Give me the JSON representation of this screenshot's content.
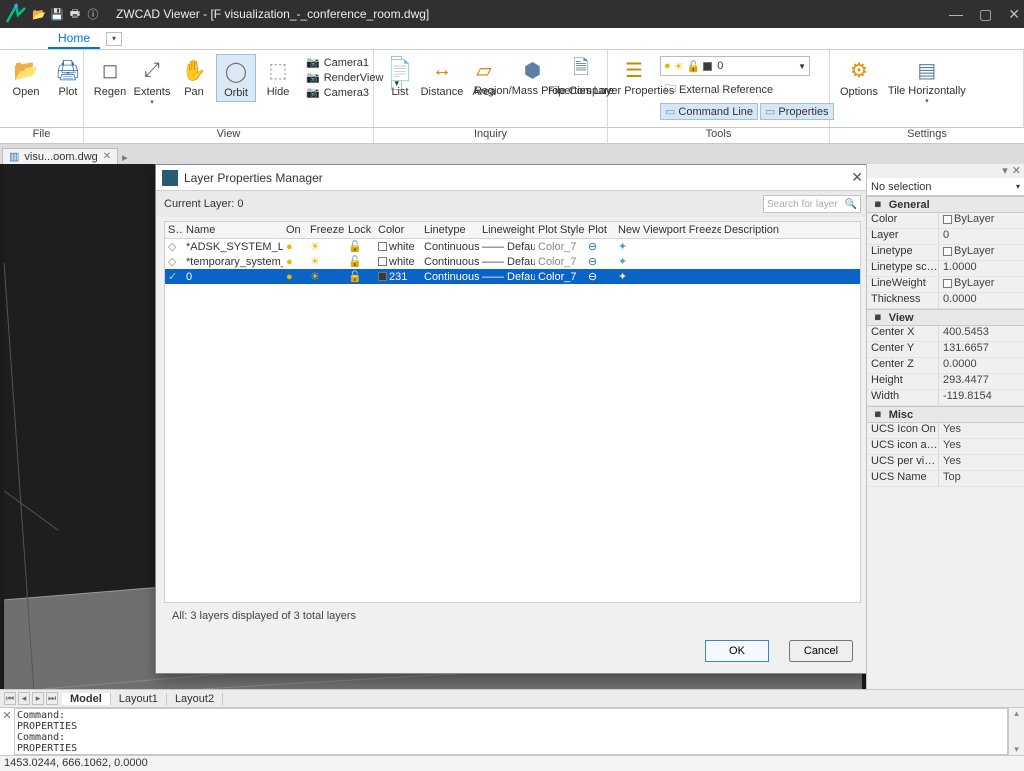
{
  "titlebar": {
    "app": "ZWCAD Viewer",
    "doc": "[F            visualization_-_conference_room.dwg]"
  },
  "menu": {
    "home": "Home"
  },
  "ribbon": {
    "file": {
      "label": "File",
      "open": "Open",
      "plot": "Plot"
    },
    "view": {
      "label": "View",
      "regen": "Regen",
      "extents": "Extents",
      "pan": "Pan",
      "orbit": "Orbit",
      "hide": "Hide",
      "cam1": "Camera1",
      "render": "RenderView",
      "cam3": "Camera3"
    },
    "inquiry": {
      "label": "Inquiry",
      "list": "List",
      "distance": "Distance",
      "area": "Area",
      "regionmass": "Region/Mass\nProperties",
      "compare": "File\nCompare"
    },
    "tools": {
      "label": "Tools",
      "layerprops": "Layer\nProperties",
      "xref": "External Reference",
      "cmdline": "Command Line",
      "props": "Properties",
      "combo": "0"
    },
    "settings": {
      "label": "Settings",
      "options": "Options",
      "tile": "Tile\nHorizontally"
    }
  },
  "doctab": {
    "name": "visu...oom.dwg"
  },
  "dialog": {
    "title": "Layer Properties Manager",
    "current": "Current Layer: 0",
    "search_ph": "Search for layer",
    "cols": [
      "S…",
      "Name",
      "On",
      "Freeze",
      "Lock",
      "Color",
      "Linetype",
      "Lineweight",
      "Plot Style",
      "Plot",
      "New Viewport Freeze",
      "Description"
    ],
    "rows": [
      {
        "name": "*ADSK_SYSTEM_LIG…",
        "color": "white",
        "colorhex": "#ffffff",
        "lt": "Continuous",
        "lw": "—",
        "ps": "Default",
        "pscol": "Color_7",
        "sel": false
      },
      {
        "name": "*temporary_system_ca…",
        "color": "white",
        "colorhex": "#ffffff",
        "lt": "Continuous",
        "lw": "—",
        "ps": "Default",
        "pscol": "Color_7",
        "sel": false
      },
      {
        "name": "0",
        "color": "231",
        "colorhex": "#3a3a3a",
        "lt": "Continuous",
        "lw": "—",
        "ps": "Default",
        "pscol": "Color_7",
        "sel": true
      }
    ],
    "status": "All: 3 layers displayed of 3 total layers",
    "ok": "OK",
    "cancel": "Cancel"
  },
  "props": {
    "sel": "No selection",
    "sections": [
      {
        "name": "General",
        "rows": [
          [
            "Color",
            "ByLayer"
          ],
          [
            "Layer",
            "0"
          ],
          [
            "Linetype",
            "ByLayer"
          ],
          [
            "Linetype scale",
            "1.0000"
          ],
          [
            "LineWeight",
            "ByLayer"
          ],
          [
            "Thickness",
            "0.0000"
          ]
        ]
      },
      {
        "name": "View",
        "rows": [
          [
            "Center X",
            "400.5453"
          ],
          [
            "Center Y",
            "131.6657"
          ],
          [
            "Center Z",
            "0.0000"
          ],
          [
            "Height",
            "293.4477"
          ],
          [
            "Width",
            "-119.8154"
          ]
        ]
      },
      {
        "name": "Misc",
        "rows": [
          [
            "UCS Icon On",
            "Yes"
          ],
          [
            "UCS icon at ori…",
            "Yes"
          ],
          [
            "UCS per viewp…",
            "Yes"
          ],
          [
            "UCS Name",
            "Top"
          ]
        ]
      }
    ]
  },
  "layout": {
    "tabs": [
      "Model",
      "Layout1",
      "Layout2"
    ],
    "active": 0
  },
  "cmd": {
    "lines": [
      "Command:",
      "PROPERTIES",
      "Command:",
      "PROPERTIES",
      "Command:"
    ],
    "prompt": ""
  },
  "status": "1453.0244, 666.1062, 0.0000"
}
